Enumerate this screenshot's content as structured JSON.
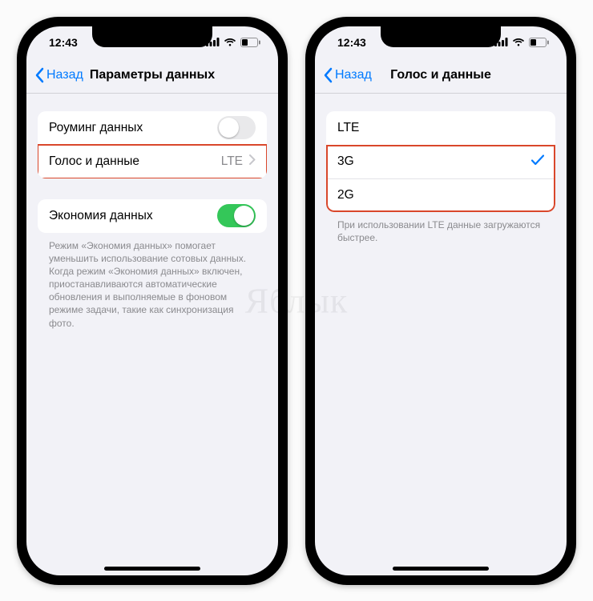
{
  "status": {
    "time": "12:43"
  },
  "watermark": "Яблык",
  "left": {
    "back": "Назад",
    "title": "Параметры данных",
    "roaming_label": "Роуминг данных",
    "voice_label": "Голос и данные",
    "voice_value": "LTE",
    "lowdata_label": "Экономия данных",
    "lowdata_note": "Режим «Экономия данных» помогает уменьшить использование сотовых данных. Когда режим «Экономия данных» включен, приостанавливаются автоматические обновления и выполняемые в фоновом режиме задачи, такие как синхронизация фото."
  },
  "right": {
    "back": "Назад",
    "title": "Голос и данные",
    "opt_lte": "LTE",
    "opt_3g": "3G",
    "opt_2g": "2G",
    "note": "При использовании LTE данные загружаются быстрее."
  }
}
